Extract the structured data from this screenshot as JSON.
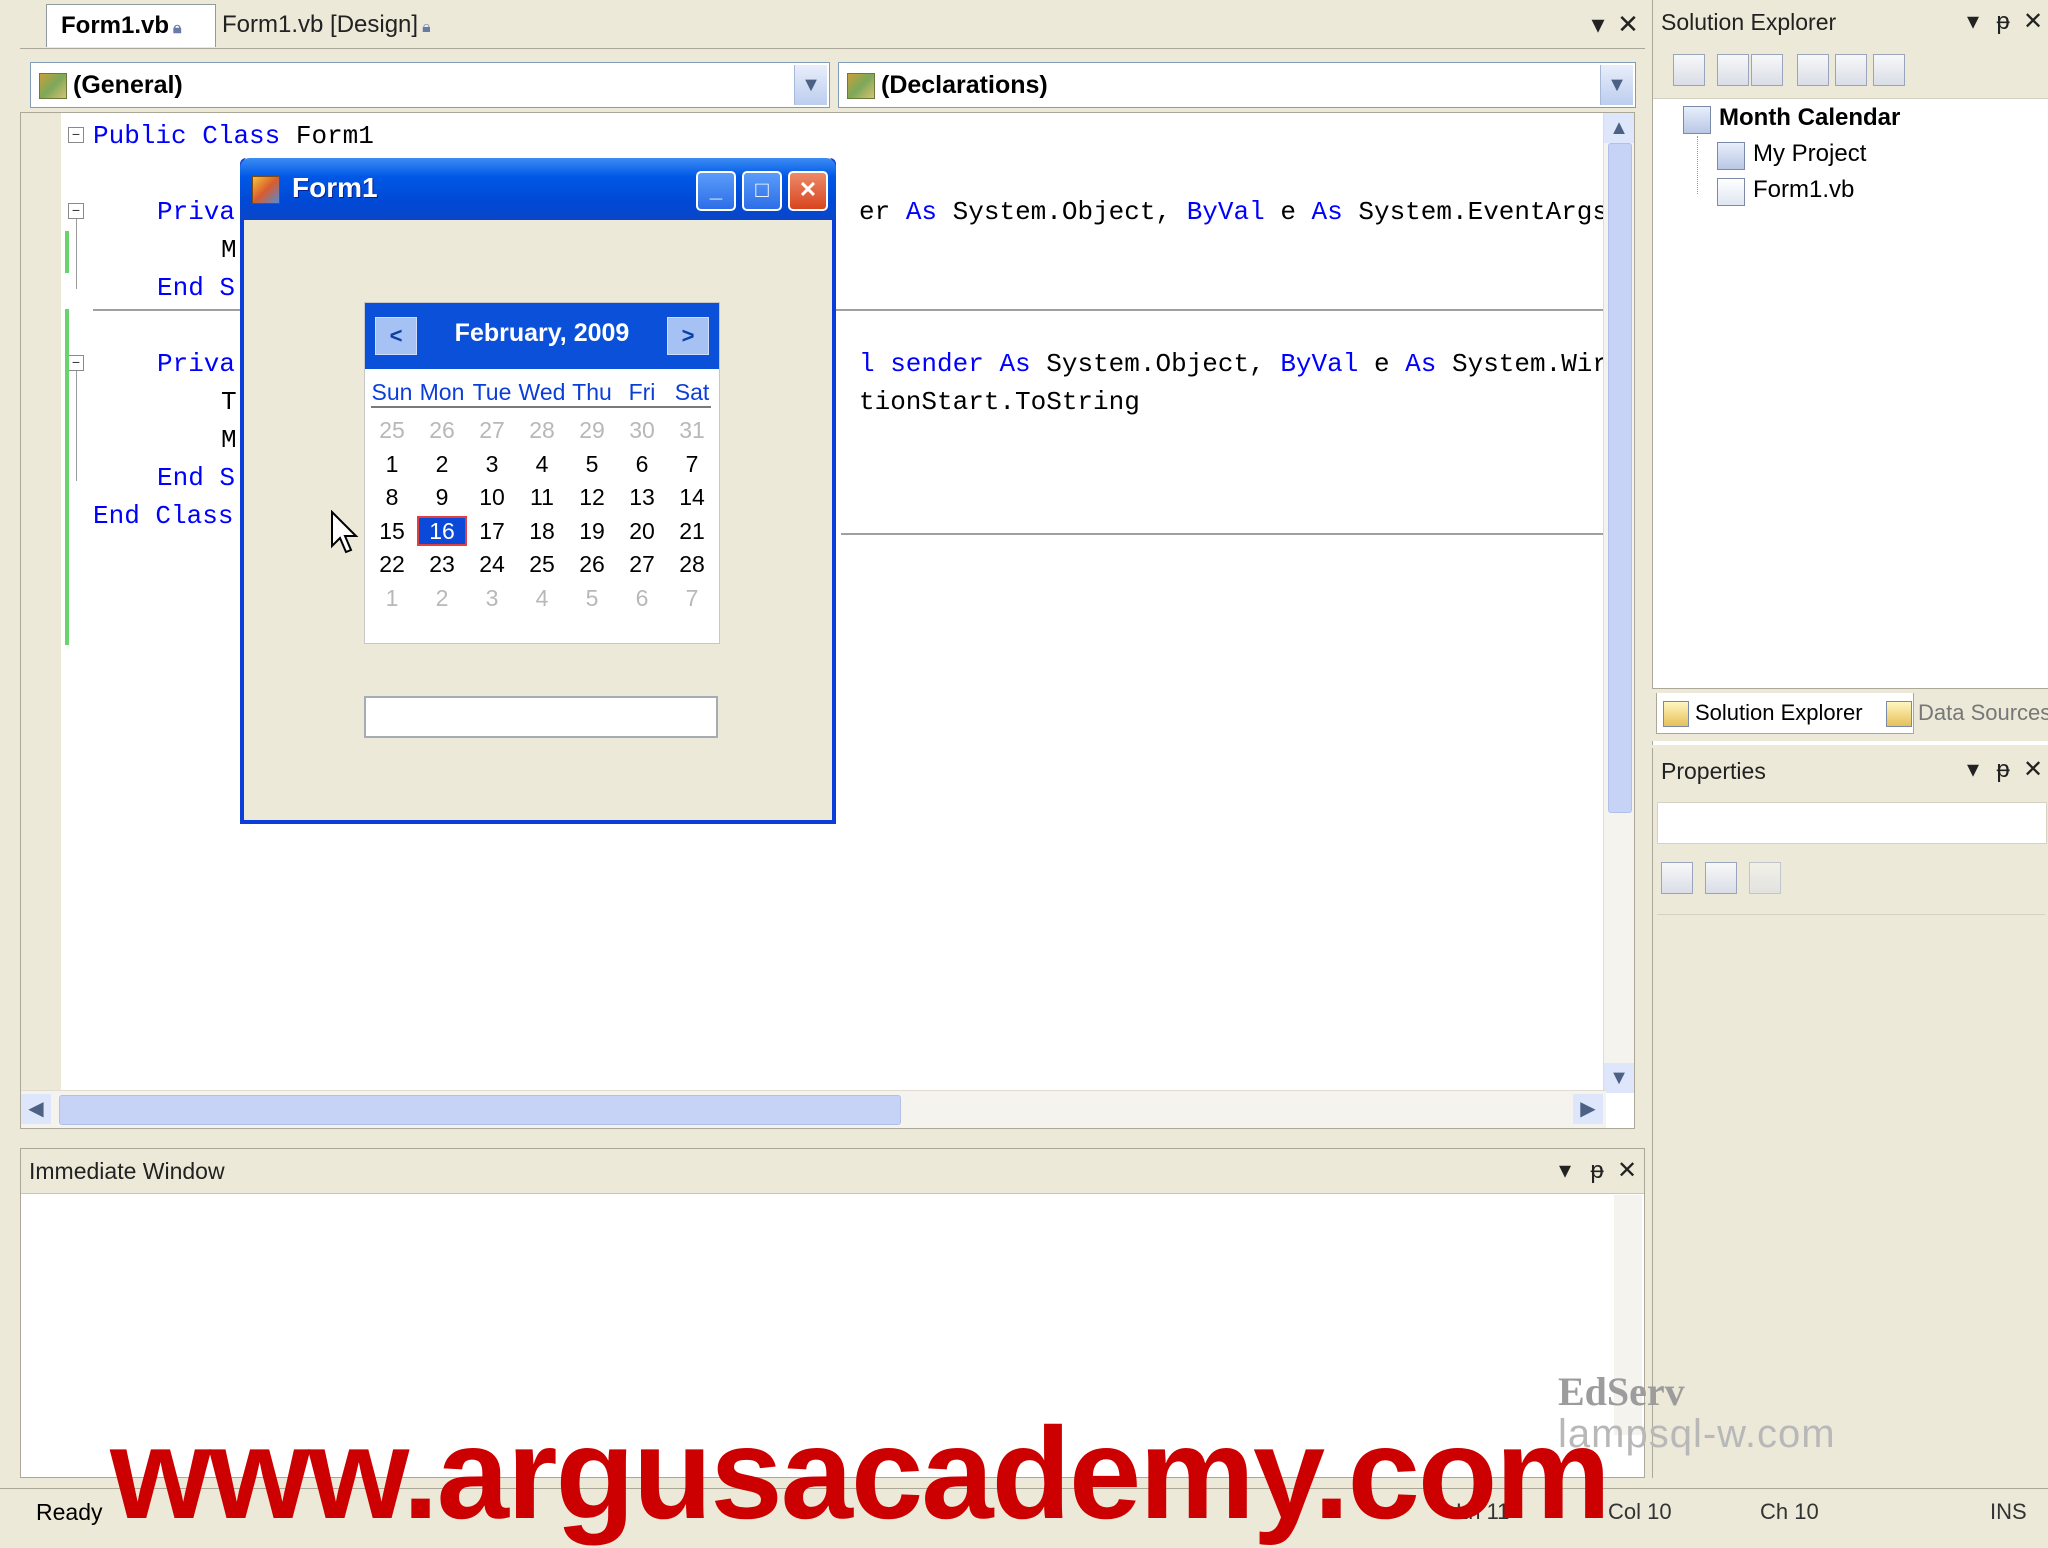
{
  "editor": {
    "tabs": [
      {
        "label": "Form1.vb",
        "active": true
      },
      {
        "label": "Form1.vb [Design]",
        "active": false
      }
    ],
    "dropdown_left": "(General)",
    "dropdown_right": "(Declarations)",
    "code": {
      "line1_kw1": "Public",
      "line1_kw2": "Class",
      "line1_name": "Form1",
      "line2_left": "Priva",
      "line2_right_a": "er",
      "line2_right_b": "As",
      "line2_right_c": "System.Object,",
      "line2_right_d": "ByVal",
      "line2_right_e": "e",
      "line2_right_f": "As",
      "line2_right_g": "System.EventArgs",
      "line3_left": "M",
      "line4_left_kw": "End",
      "line4_left_rest": "S",
      "line5_left": "Priva",
      "line5_right_a": "l sender",
      "line5_right_b": "As",
      "line5_right_c": "System.Object,",
      "line5_right_d": "ByVal",
      "line5_right_e": "e",
      "line5_right_f": "As",
      "line5_right_g": "System.Wir",
      "line6_left": "T",
      "line6_right": "tionStart.ToString",
      "line7_left": "M",
      "line8_left_kw": "End",
      "line8_left_rest": "S",
      "line9_kw1": "End",
      "line9_kw2": "Class"
    }
  },
  "form1": {
    "title": "Form1",
    "minimize_glyph": "_",
    "maximize_glyph": "□",
    "close_glyph": "✕",
    "calendar": {
      "month_label": "February, 2009",
      "prev_glyph": "<",
      "next_glyph": ">",
      "days_of_week": [
        "Sun",
        "Mon",
        "Tue",
        "Wed",
        "Thu",
        "Fri",
        "Sat"
      ],
      "weeks": [
        [
          "25",
          "26",
          "27",
          "28",
          "29",
          "30",
          "31"
        ],
        [
          "1",
          "2",
          "3",
          "4",
          "5",
          "6",
          "7"
        ],
        [
          "8",
          "9",
          "10",
          "11",
          "12",
          "13",
          "14"
        ],
        [
          "15",
          "16",
          "17",
          "18",
          "19",
          "20",
          "21"
        ],
        [
          "22",
          "23",
          "24",
          "25",
          "26",
          "27",
          "28"
        ],
        [
          "1",
          "2",
          "3",
          "4",
          "5",
          "6",
          "7"
        ]
      ],
      "selected_day": "16"
    },
    "textbox_value": ""
  },
  "immediate_window": {
    "title": "Immediate Window"
  },
  "solution_explorer": {
    "title": "Solution Explorer",
    "tree": {
      "root": "Month Calendar",
      "children": [
        "My Project",
        "Form1.vb"
      ]
    },
    "bottom_tabs": [
      "Solution Explorer",
      "Data Sources"
    ]
  },
  "properties": {
    "title": "Properties"
  },
  "status_bar": {
    "ready": "Ready",
    "ln": "Ln 11",
    "col": "Col 10",
    "ch": "Ch 10",
    "ins": "INS"
  },
  "watermarks": {
    "edserv": "EdServ",
    "small_url": "lampsql-w.com",
    "argus": "www.argusacademy.com"
  },
  "panel_glyphs": {
    "dropdown": "▾",
    "pin": "ᵽ",
    "close": "✕"
  }
}
